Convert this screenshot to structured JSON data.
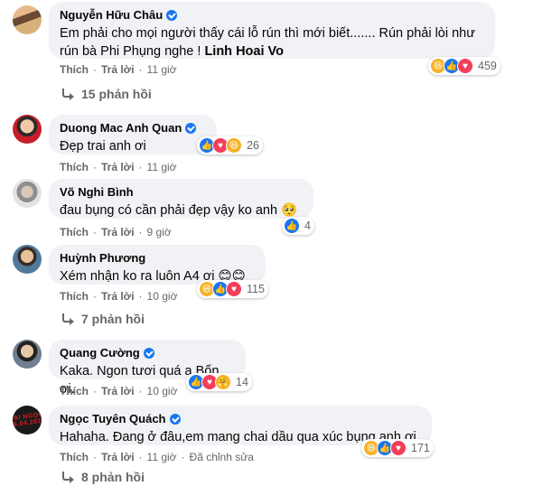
{
  "comments": [
    {
      "name": "Nguyễn Hữu Châu",
      "verified": true,
      "text": "Em phải cho mọi người thấy cái lỗ rún thì mới biết....... Rún phải lòi như rún bà Phi Phụng nghe ! ",
      "mention": "Linh Hoai Vo",
      "like": "Thích",
      "reply": "Trả lời",
      "time": "11 giờ",
      "reactions": [
        "haha",
        "like",
        "love"
      ],
      "reaction_count": "459",
      "replies": "15 phản hồi"
    },
    {
      "name": "Duong Mac Anh Quan",
      "verified": true,
      "text": "Đẹp trai anh ơi",
      "like": "Thích",
      "reply": "Trả lời",
      "time": "11 giờ",
      "reactions": [
        "like",
        "love",
        "haha"
      ],
      "reaction_count": "26"
    },
    {
      "name": "Võ Nghi Bình",
      "verified": false,
      "text": "đau bụng có cần phải đẹp vậy ko anh 🥺",
      "like": "Thích",
      "reply": "Trả lời",
      "time": "9 giờ",
      "reactions": [
        "like"
      ],
      "reaction_count": "4"
    },
    {
      "name": "Huỳnh Phương",
      "verified": false,
      "text": "Xém nhận ko ra luôn A4 ơi 😊😊",
      "like": "Thích",
      "reply": "Trả lời",
      "time": "10 giờ",
      "reactions": [
        "haha",
        "like",
        "love"
      ],
      "reaction_count": "115",
      "replies": "7 phản hồi"
    },
    {
      "name": "Quang Cường",
      "verified": true,
      "text": "Kaka. Ngon tươi quá a Bốn ơi.",
      "like": "Thích",
      "reply": "Trả lời",
      "time": "10 giờ",
      "reactions": [
        "like",
        "love",
        "care"
      ],
      "reaction_count": "14"
    },
    {
      "name": "Ngọc Tuyên Quách",
      "verified": true,
      "text": "Hahaha. Đang ở đâu,em mang chai dầu qua xúc bụng anh ơi",
      "like": "Thích",
      "reply": "Trả lời",
      "time": "11 giờ",
      "edited": "Đã chỉnh sửa",
      "reactions": [
        "haha",
        "like",
        "love"
      ],
      "reaction_count": "171",
      "replies": "8 phản hồi"
    }
  ],
  "avatar_badge_text": "ĐẠI NGỌC 06.04.2021",
  "colors": {
    "bubble": "#f0f2f5",
    "meta": "#65676b",
    "like": "#1877f2",
    "love": "#f33e58",
    "haha": "#f7b125"
  }
}
